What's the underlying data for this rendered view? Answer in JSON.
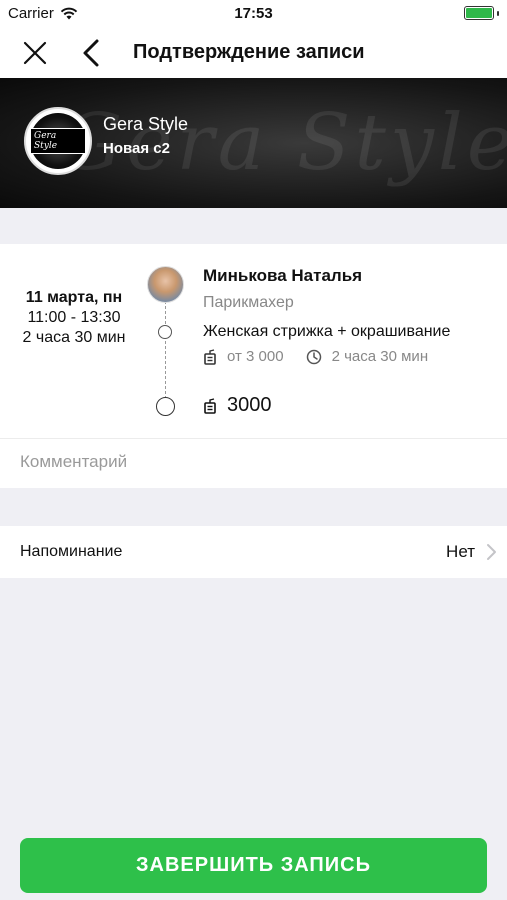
{
  "status_bar": {
    "carrier": "Carrier",
    "time": "17:53"
  },
  "nav": {
    "title": "Подтверждение записи"
  },
  "salon": {
    "name": "Gera Style",
    "subtitle": "Новая с2",
    "banner_text": "Gera Style",
    "logo_text": "Gera Style"
  },
  "appointment": {
    "date": "11 марта, пн",
    "time_range": "11:00 - 13:30",
    "duration": "2 часа 30 мин",
    "master_name": "Минькова Наталья",
    "master_role": "Парикмахер",
    "service_name": "Женская стрижка + окрашивание",
    "service_price": "от 3 000",
    "service_duration": "2 часа 30 мин",
    "total": "3000"
  },
  "comment": {
    "placeholder": "Комментарий"
  },
  "reminder": {
    "label": "Напоминание",
    "value": "Нет"
  },
  "finish_button": {
    "label": "ЗАВЕРШИТЬ ЗАПИСЬ"
  },
  "colors": {
    "accent_green": "#2ec04a",
    "background": "#efeff4"
  },
  "icons": [
    "wifi-icon",
    "battery-icon",
    "close-icon",
    "back-chevron-icon",
    "price-tag-icon",
    "clock-icon",
    "chevron-right-icon"
  ]
}
